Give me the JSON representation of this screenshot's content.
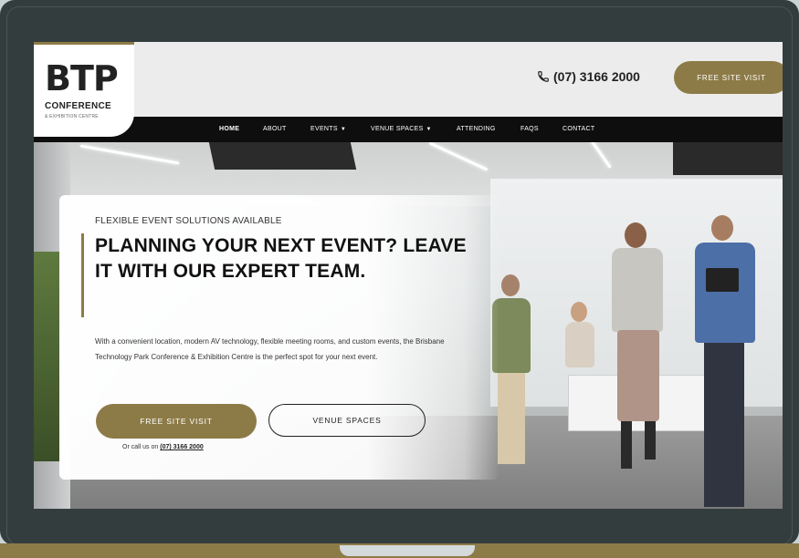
{
  "logo": {
    "mark": "BTP",
    "line1": "CONFERENCE",
    "line2": "& EXHIBITION CENTRE"
  },
  "header": {
    "phone_icon": "phone-icon",
    "phone": "(07) 3166 2000",
    "cta": "FREE SITE VISIT"
  },
  "nav": {
    "items": [
      {
        "label": "HOME",
        "active": true
      },
      {
        "label": "ABOUT"
      },
      {
        "label": "EVENTS",
        "dropdown": true
      },
      {
        "label": "VENUE SPACES",
        "dropdown": true
      },
      {
        "label": "ATTENDING"
      },
      {
        "label": "FAQS"
      },
      {
        "label": "CONTACT"
      }
    ],
    "caret": "▼"
  },
  "hero": {
    "eyebrow": "FLEXIBLE EVENT SOLUTIONS AVAILABLE",
    "headline": "PLANNING YOUR NEXT EVENT? LEAVE IT WITH OUR EXPERT TEAM.",
    "body": "With a convenient location, modern AV technology, flexible meeting rooms, and custom events, the Brisbane Technology Park Conference & Exhibition Centre is the perfect spot for your next event.",
    "primary_button": "FREE SITE VISIT",
    "secondary_button": "VENUE SPACES",
    "call_prefix": "Or call us on",
    "call_number": "(07) 3166 2000"
  },
  "colors": {
    "accent": "#8d7b47",
    "nav_bg": "#0e0e0e",
    "frame": "#343d3e"
  }
}
